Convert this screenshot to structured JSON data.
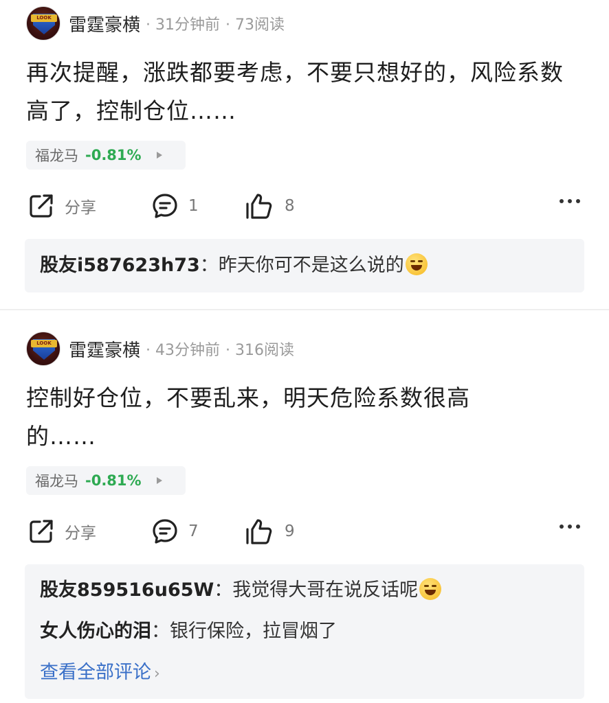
{
  "posts": [
    {
      "author": "雷霆豪横",
      "time": "· 31分钟前",
      "reads": "· 73阅读",
      "content": "再次提醒，涨跌都要考虑，不要只想好的，风险系数高了，控制仓位……",
      "stock": {
        "name": "福龙马",
        "change": "-0.81%"
      },
      "actions": {
        "share": "分享",
        "comments": "1",
        "likes": "8"
      },
      "comments": [
        {
          "user": "股友i587623h73",
          "sep": "：",
          "text": "昨天你可不是这么说的"
        }
      ]
    },
    {
      "author": "雷霆豪横",
      "time": "· 43分钟前",
      "reads": "· 316阅读",
      "content": "控制好仓位，不要乱来，明天危险系数很高的……",
      "stock": {
        "name": "福龙马",
        "change": "-0.81%"
      },
      "actions": {
        "share": "分享",
        "comments": "7",
        "likes": "9"
      },
      "comments": [
        {
          "user": "股友859516u65W",
          "sep": "：",
          "text": "我觉得大哥在说反话呢"
        },
        {
          "user": "女人伤心的泪",
          "sep": "：",
          "text": "银行保险，拉冒烟了"
        }
      ],
      "view_all": "查看全部评论"
    }
  ],
  "avatar_badge": "LOOK",
  "colors": {
    "stock_down": "#2eaa52",
    "link": "#3a70c8",
    "chip_bg": "#f4f5f7"
  },
  "icons": [
    "share-icon",
    "comment-icon",
    "like-icon",
    "more-icon",
    "chevron-right-icon"
  ]
}
